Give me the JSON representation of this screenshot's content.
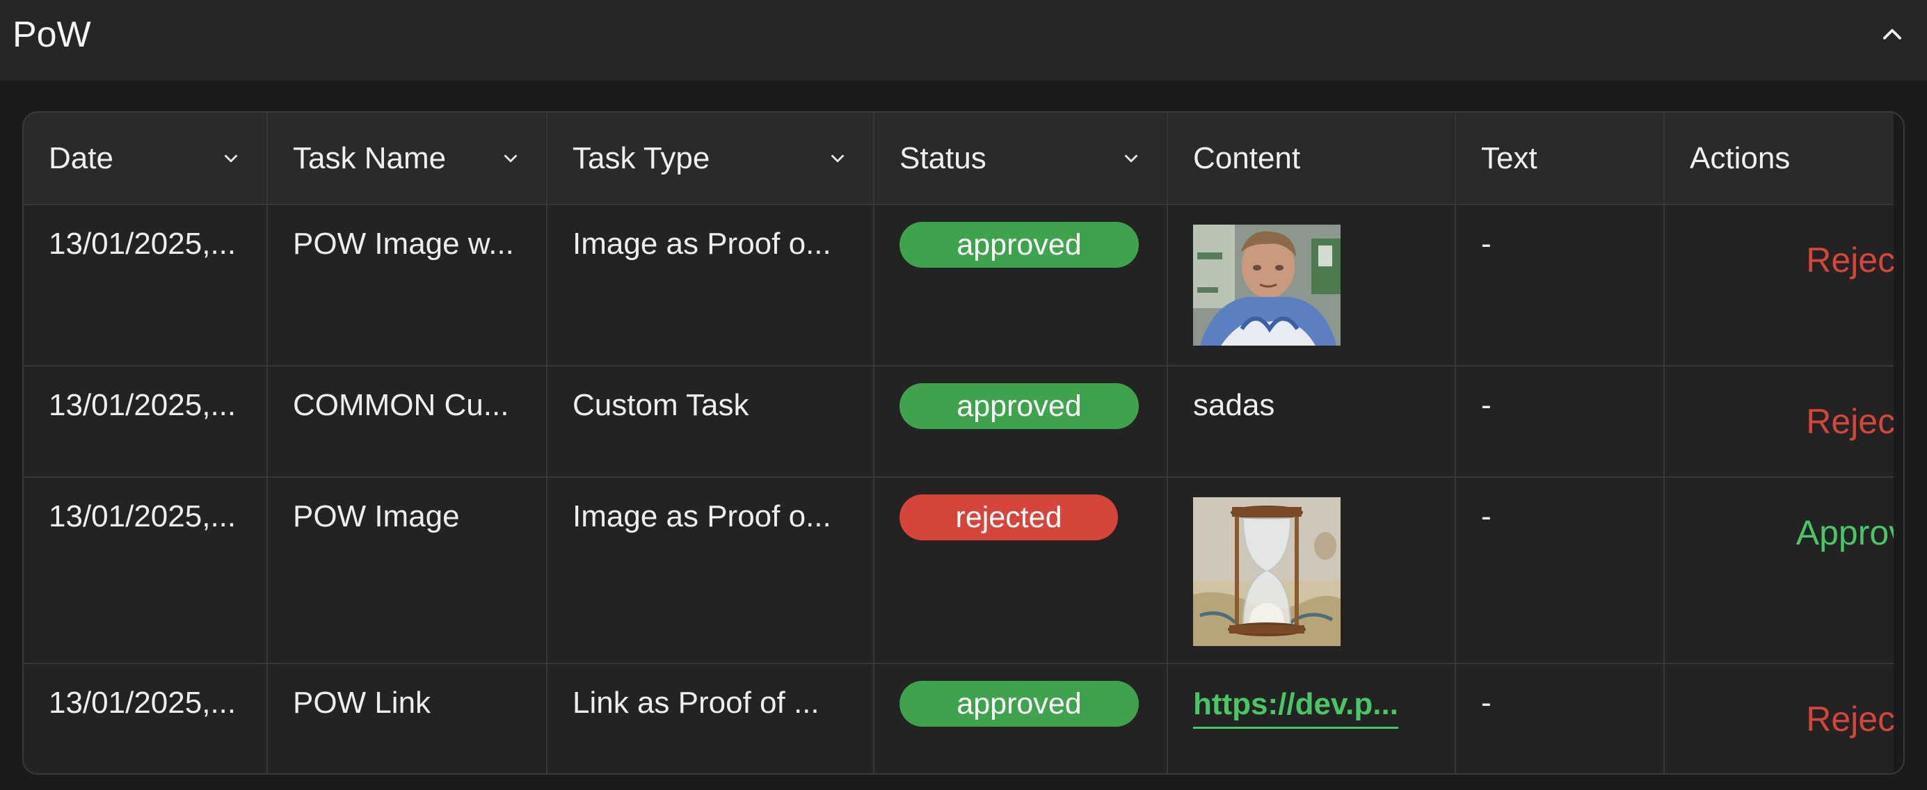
{
  "panel": {
    "title": "PoW"
  },
  "table": {
    "columns": [
      {
        "label": "Date",
        "sortable": true
      },
      {
        "label": "Task Name",
        "sortable": true
      },
      {
        "label": "Task Type",
        "sortable": true
      },
      {
        "label": "Status",
        "sortable": true
      },
      {
        "label": "Content",
        "sortable": false
      },
      {
        "label": "Text",
        "sortable": false
      },
      {
        "label": "Actions",
        "sortable": false
      }
    ],
    "rows": [
      {
        "date": "13/01/2025,...",
        "task_name": "POW Image w...",
        "task_type": "Image as Proof o...",
        "status": "approved",
        "content_type": "image",
        "content_icon": "portrait-thumbnail",
        "text": "-",
        "action": "Reject"
      },
      {
        "date": "13/01/2025,...",
        "task_name": "COMMON Cu...",
        "task_type": "Custom Task",
        "status": "approved",
        "content_type": "text",
        "content": "sadas",
        "text": "-",
        "action": "Reject"
      },
      {
        "date": "13/01/2025,...",
        "task_name": "POW Image",
        "task_type": "Image as Proof o...",
        "status": "rejected",
        "content_type": "image",
        "content_icon": "hourglass-thumbnail",
        "text": "-",
        "action": "Approve"
      },
      {
        "date": "13/01/2025,...",
        "task_name": "POW Link",
        "task_type": "Link as Proof of ...",
        "status": "approved",
        "content_type": "link",
        "content": "https://dev.p...",
        "text": "-",
        "action": "Reject"
      }
    ]
  },
  "colors": {
    "approved": "#3fa34d",
    "rejected": "#d6453a",
    "link": "#49c767",
    "background": "#1b1b1b"
  }
}
